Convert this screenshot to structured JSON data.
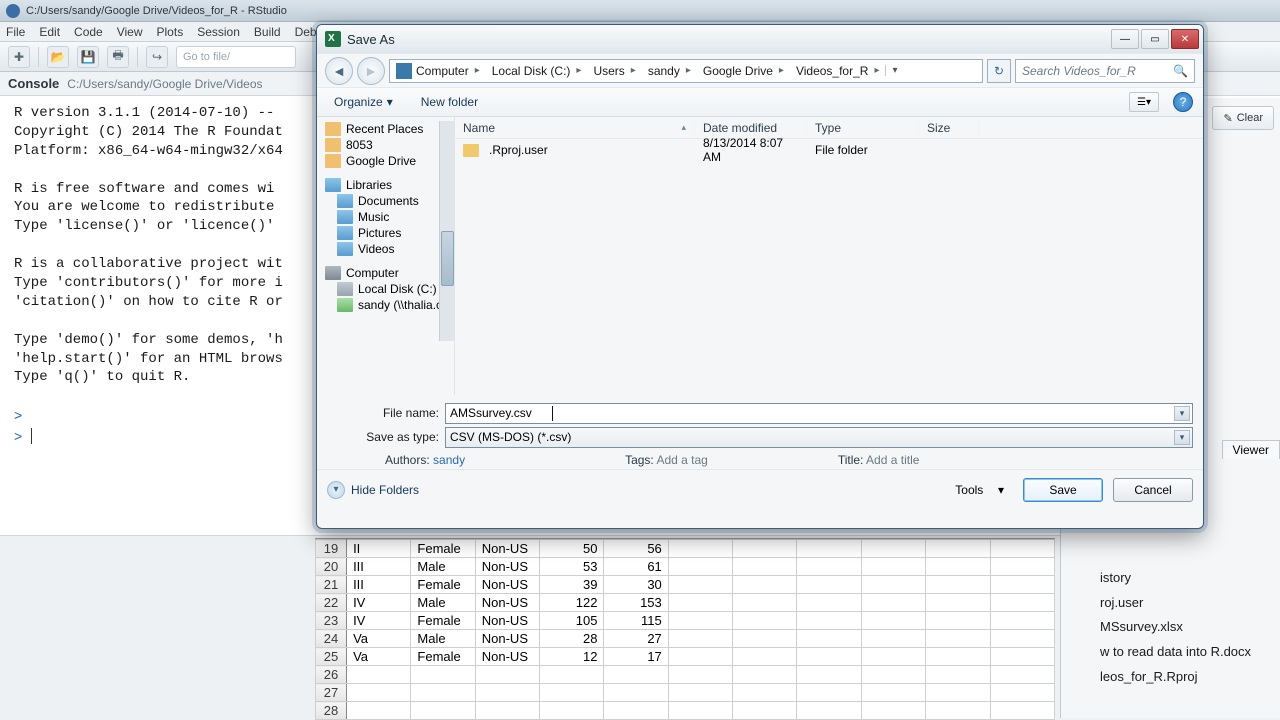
{
  "rstudio": {
    "title": "C:/Users/sandy/Google Drive/Videos_for_R - RStudio",
    "menu": [
      "File",
      "Edit",
      "Code",
      "View",
      "Plots",
      "Session",
      "Build",
      "Debu"
    ],
    "goto_file": "Go to file/",
    "console_label": "Console",
    "console_path": "C:/Users/sandy/Google Drive/Videos",
    "console_text": "R version 3.1.1 (2014-07-10) --\nCopyright (C) 2014 The R Foundat\nPlatform: x86_64-w64-mingw32/x64\n\nR is free software and comes wi\nYou are welcome to redistribute \nType 'license()' or 'licence()' \n\nR is a collaborative project wit\nType 'contributors()' for more i\n'citation()' on how to cite R or\n\nType 'demo()' for some demos, 'h\n'help.start()' for an HTML brows\nType 'q()' to quit R.",
    "prompt": ">",
    "clear": "Clear",
    "viewer_tab": "Viewer",
    "history_lbl": "istory",
    "files": [
      "roj.user",
      "MSsurvey.xlsx",
      "w to read data into R.docx",
      "leos_for_R.Rproj"
    ]
  },
  "sheet": {
    "rows": [
      {
        "n": "19",
        "a": "II",
        "b": "Female",
        "c": "Non-US",
        "d": "50",
        "e": "56"
      },
      {
        "n": "20",
        "a": "III",
        "b": "Male",
        "c": "Non-US",
        "d": "53",
        "e": "61"
      },
      {
        "n": "21",
        "a": "III",
        "b": "Female",
        "c": "Non-US",
        "d": "39",
        "e": "30"
      },
      {
        "n": "22",
        "a": "IV",
        "b": "Male",
        "c": "Non-US",
        "d": "122",
        "e": "153"
      },
      {
        "n": "23",
        "a": "IV",
        "b": "Female",
        "c": "Non-US",
        "d": "105",
        "e": "115"
      },
      {
        "n": "24",
        "a": "Va",
        "b": "Male",
        "c": "Non-US",
        "d": "28",
        "e": "27"
      },
      {
        "n": "25",
        "a": "Va",
        "b": "Female",
        "c": "Non-US",
        "d": "12",
        "e": "17"
      },
      {
        "n": "26",
        "a": "",
        "b": "",
        "c": "",
        "d": "",
        "e": ""
      },
      {
        "n": "27",
        "a": "",
        "b": "",
        "c": "",
        "d": "",
        "e": ""
      },
      {
        "n": "28",
        "a": "",
        "b": "",
        "c": "",
        "d": "",
        "e": ""
      }
    ]
  },
  "dialog": {
    "title": "Save As",
    "crumbs": [
      "Computer",
      "Local Disk (C:)",
      "Users",
      "sandy",
      "Google Drive",
      "Videos_for_R"
    ],
    "search_ph": "Search Videos_for_R",
    "organize": "Organize",
    "new_folder": "New folder",
    "cols": {
      "name": "Name",
      "date": "Date modified",
      "type": "Type",
      "size": "Size"
    },
    "row": {
      "name": ".Rproj.user",
      "date": "8/13/2014 8:07 AM",
      "type": "File folder"
    },
    "tree": {
      "recent": "Recent Places",
      "p8053": "8053",
      "gdrive": "Google Drive",
      "libraries": "Libraries",
      "docs": "Documents",
      "music": "Music",
      "pics": "Pictures",
      "vids": "Videos",
      "computer": "Computer",
      "localc": "Local Disk (C:)",
      "net": "sandy (\\\\thalia.cl"
    },
    "file_name_lbl": "File name:",
    "file_name": "AMSsurvey.csv",
    "save_type_lbl": "Save as type:",
    "save_type": "CSV (MS-DOS) (*.csv)",
    "authors_lbl": "Authors:",
    "authors": "sandy",
    "tags_lbl": "Tags:",
    "tags": "Add a tag",
    "titlef_lbl": "Title:",
    "titlef": "Add a title",
    "hide_folders": "Hide Folders",
    "tools": "Tools",
    "save": "Save",
    "cancel": "Cancel"
  }
}
